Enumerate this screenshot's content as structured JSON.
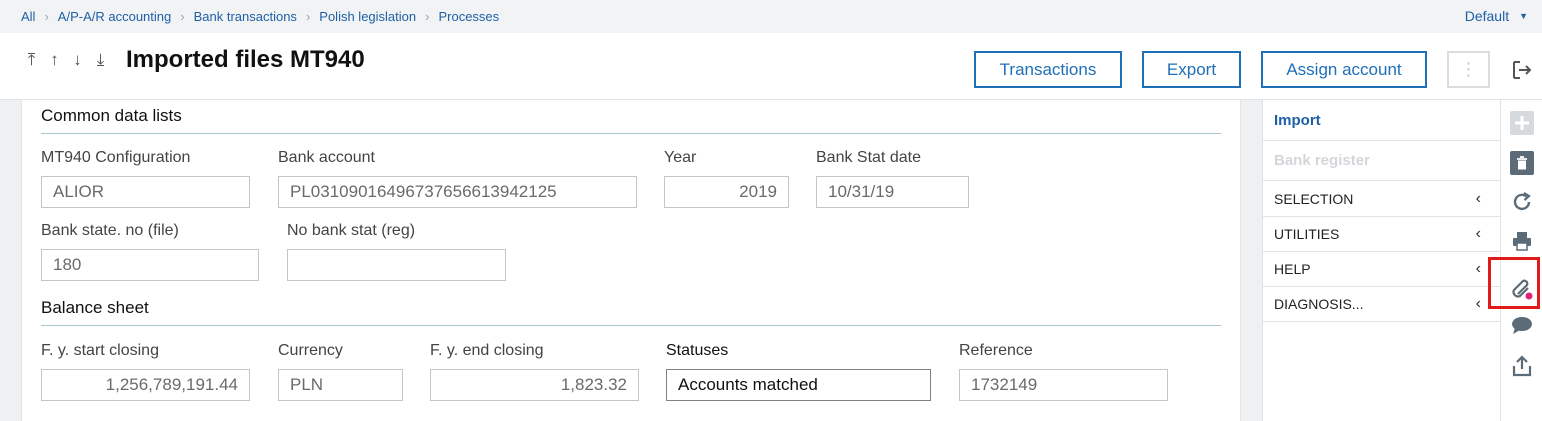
{
  "breadcrumb": {
    "items": [
      "All",
      "A/P-A/R accounting",
      "Bank transactions",
      "Polish legislation",
      "Processes"
    ],
    "default_label": "Default"
  },
  "header": {
    "title": "Imported files MT940",
    "buttons": {
      "transactions": "Transactions",
      "export": "Export",
      "assign_account": "Assign account"
    }
  },
  "sections": {
    "common": {
      "title": "Common data lists",
      "mt940_config": {
        "label": "MT940 Configuration",
        "value": "ALIOR"
      },
      "bank_account": {
        "label": "Bank account",
        "value": "PL03109016496737656613942125"
      },
      "year": {
        "label": "Year",
        "value": "2019"
      },
      "bank_stat_date": {
        "label": "Bank Stat date",
        "value": "10/31/19"
      },
      "bank_state_no": {
        "label": "Bank state. no (file)",
        "value": "180"
      },
      "no_bank_stat": {
        "label": "No bank stat (reg)",
        "value": ""
      }
    },
    "balance": {
      "title": "Balance sheet",
      "fy_start": {
        "label": "F. y. start closing",
        "value": "1,256,789,191.44"
      },
      "currency": {
        "label": "Currency",
        "value": "PLN"
      },
      "fy_end": {
        "label": "F. y. end closing",
        "value": "1,823.32"
      },
      "statuses": {
        "label": "Statuses",
        "value": "Accounts matched"
      },
      "reference": {
        "label": "Reference",
        "value": "1732149"
      }
    }
  },
  "right_panel": {
    "import": "Import",
    "bank_register": "Bank register",
    "menus": [
      "SELECTION",
      "UTILITIES",
      "HELP",
      "DIAGNOSIS..."
    ]
  },
  "icons": [
    "plus-icon",
    "trash-icon",
    "refresh-icon",
    "print-icon",
    "attachment-icon",
    "comment-icon",
    "share-icon"
  ],
  "colors": {
    "accent": "#1f6fb8",
    "highlight": "#e21a1a",
    "attachment_dot": "#e0207a"
  }
}
